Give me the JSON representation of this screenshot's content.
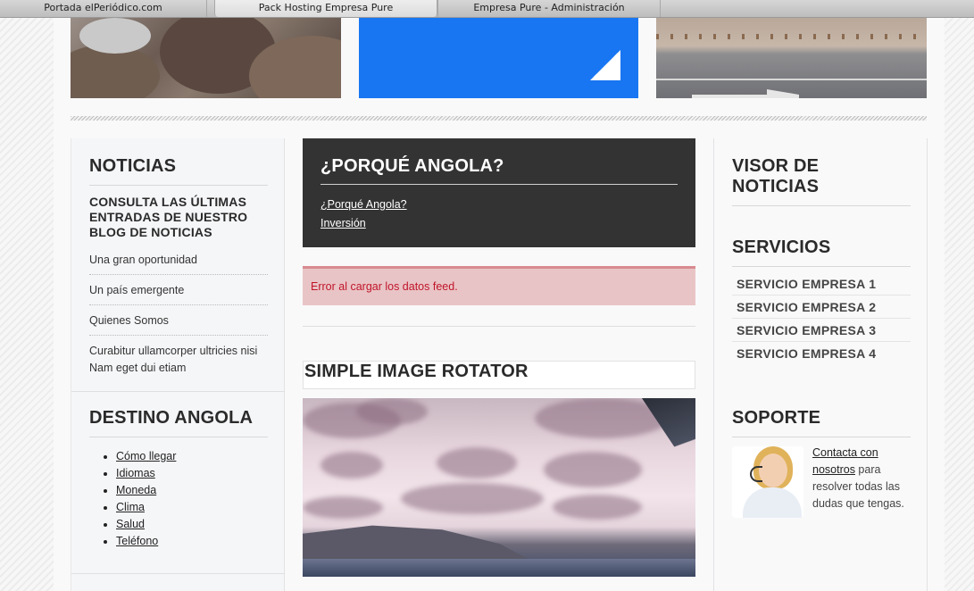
{
  "browser_tabs": [
    "Portada elPeriódico.com",
    "Pack Hosting Empresa Pure",
    "Empresa Pure - Administración"
  ],
  "left": {
    "noticias_title": "NOTICIAS",
    "noticias_subhead": "CONSULTA LAS ÚLTIMAS ENTRADAS DE NUESTRO BLOG DE NOTICIAS",
    "noticias_items": [
      "Una gran oportunidad",
      "Un país emergente",
      "Quienes Somos",
      "Curabitur ullamcorper ultricies nisi Nam eget dui etiam"
    ],
    "destino_title": "DESTINO ANGOLA",
    "destino_links": [
      "Cómo llegar",
      "Idiomas",
      "Moneda",
      "Clima",
      "Salud",
      "Teléfono"
    ]
  },
  "center": {
    "angola_title": "¿PORQUÉ ANGOLA?",
    "angola_links": [
      "¿Porqué Angola?",
      "Inversión"
    ],
    "error_message": "Error al cargar los datos feed.",
    "rotator_title": "SIMPLE IMAGE ROTATOR"
  },
  "right": {
    "visor_title": "VISOR DE NOTICIAS",
    "servicios_title": "SERVICIOS",
    "servicios_items": [
      "SERVICIO EMPRESA 1",
      "SERVICIO EMPRESA 2",
      "SERVICIO EMPRESA 3",
      "SERVICIO EMPRESA 4"
    ],
    "soporte_title": "SOPORTE",
    "soporte_link": "Contacta con nosotros",
    "soporte_text": " para resolver todas las dudas que tengas."
  },
  "colors": {
    "brand_blue": "#1876f2",
    "dark_box": "#333333",
    "error_bg": "#e9c4c6",
    "error_text": "#c0152a"
  },
  "icons": [
    "corner-arrow-icon",
    "support-agent-photo"
  ]
}
